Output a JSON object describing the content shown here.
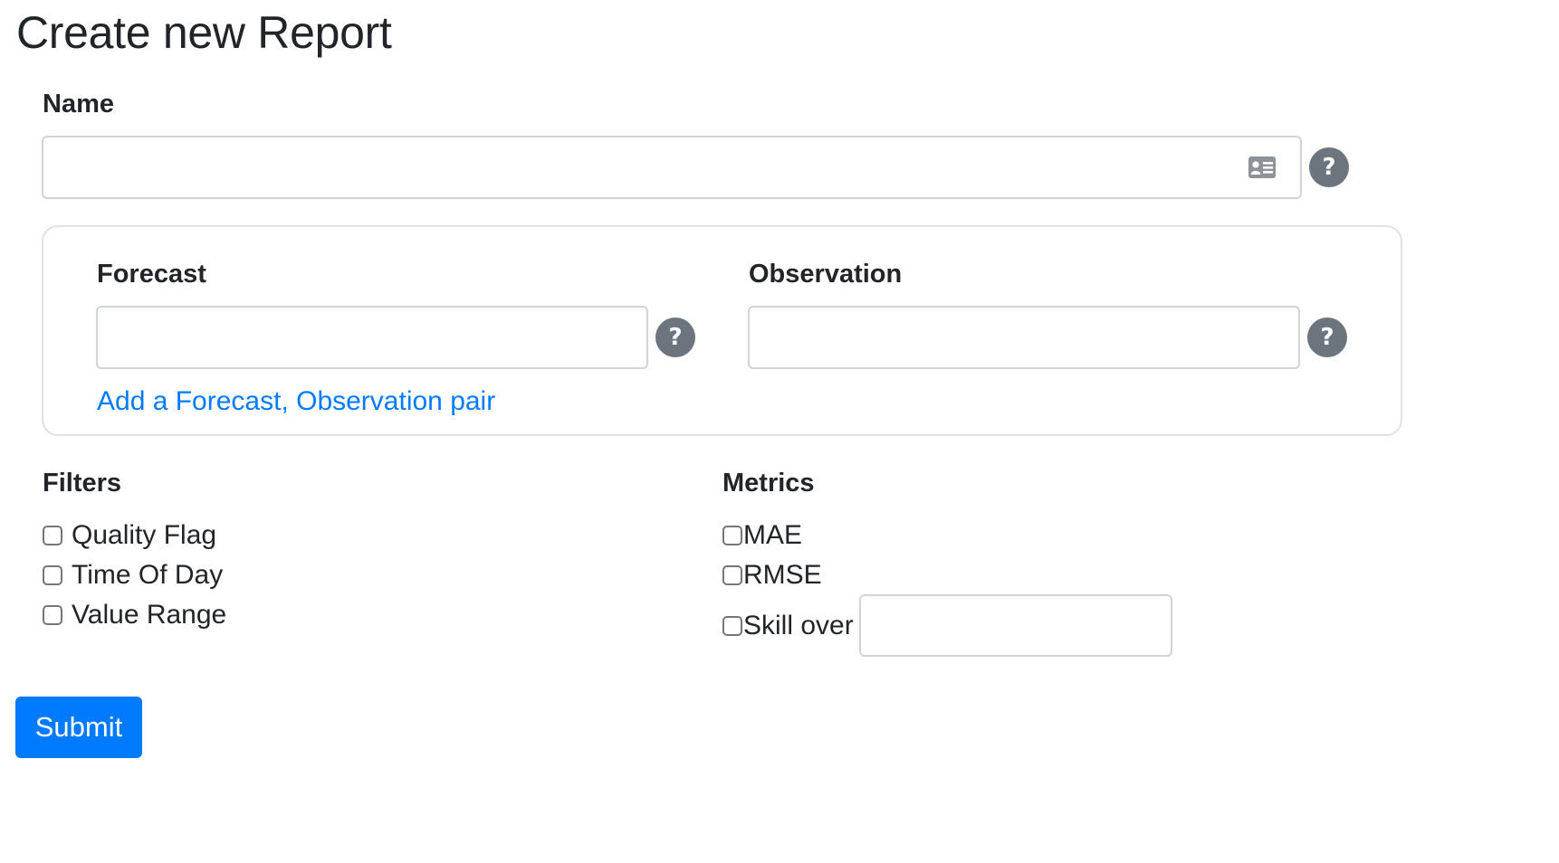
{
  "page": {
    "title": "Create new Report"
  },
  "name_field": {
    "label": "Name",
    "value": "",
    "placeholder": "",
    "help": "?",
    "autofill_icon": "contact-card-icon"
  },
  "pairs": {
    "forecast": {
      "label": "Forecast",
      "value": "",
      "help": "?"
    },
    "observation": {
      "label": "Observation",
      "value": "",
      "help": "?"
    },
    "add_pair_link": "Add a Forecast, Observation pair"
  },
  "filters": {
    "heading": "Filters",
    "options": [
      {
        "label": "Quality Flag",
        "checked": false
      },
      {
        "label": "Time Of Day",
        "checked": false
      },
      {
        "label": "Value Range",
        "checked": false
      }
    ]
  },
  "metrics": {
    "heading": "Metrics",
    "options": [
      {
        "label": "MAE",
        "checked": false
      },
      {
        "label": "RMSE",
        "checked": false
      },
      {
        "label": "Skill over",
        "checked": false
      }
    ],
    "skill_reference_value": ""
  },
  "actions": {
    "submit_label": "Submit"
  },
  "colors": {
    "primary": "#007bff",
    "help_icon_bg": "#6c757d",
    "input_border": "#ced4da",
    "text": "#212529"
  }
}
